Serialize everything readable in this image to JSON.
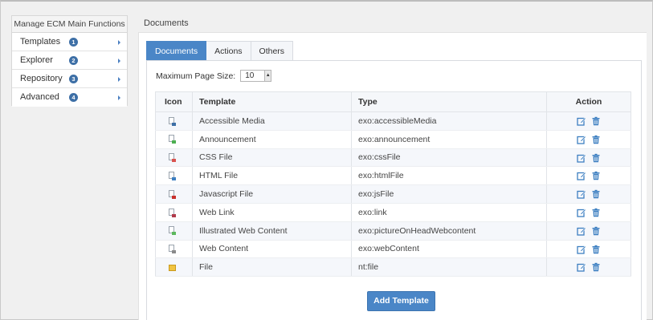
{
  "sidebar": {
    "title": "Manage ECM Main Functions",
    "items": [
      {
        "label": "Templates",
        "badge": "1"
      },
      {
        "label": "Explorer",
        "badge": "2"
      },
      {
        "label": "Repository",
        "badge": "3"
      },
      {
        "label": "Advanced",
        "badge": "4"
      }
    ]
  },
  "main": {
    "header": "Documents",
    "tabs": [
      {
        "label": "Documents",
        "active": true
      },
      {
        "label": "Actions",
        "active": false
      },
      {
        "label": "Others",
        "active": false
      }
    ],
    "page_size": {
      "label": "Maximum Page Size:",
      "value": "10"
    },
    "table": {
      "headers": {
        "icon": "Icon",
        "template": "Template",
        "type": "Type",
        "action": "Action"
      },
      "rows": [
        {
          "icon": "accessible-media-file-icon",
          "template": "Accessible Media",
          "type": "exo:accessibleMedia",
          "color": "#3d6fa6"
        },
        {
          "icon": "announcement-file-icon",
          "template": "Announcement",
          "type": "exo:announcement",
          "color": "#4caf50"
        },
        {
          "icon": "css-file-icon",
          "template": "CSS File",
          "type": "exo:cssFile",
          "color": "#d9534f"
        },
        {
          "icon": "html-file-icon",
          "template": "HTML File",
          "type": "exo:htmlFile",
          "color": "#3d7fc1"
        },
        {
          "icon": "javascript-file-icon",
          "template": "Javascript File",
          "type": "exo:jsFile",
          "color": "#c9302c"
        },
        {
          "icon": "web-link-file-icon",
          "template": "Web Link",
          "type": "exo:link",
          "color": "#b03a4a"
        },
        {
          "icon": "illustrated-web-content-file-icon",
          "template": "Illustrated Web Content",
          "type": "exo:pictureOnHeadWebcontent",
          "color": "#5cb85c"
        },
        {
          "icon": "web-content-file-icon",
          "template": "Web Content",
          "type": "exo:webContent",
          "color": "#8a8a8a"
        },
        {
          "icon": "folder-file-icon",
          "template": "File",
          "type": "nt:file",
          "color": "#f0ad4e"
        }
      ]
    },
    "add_button": "Add Template"
  },
  "colors": {
    "accent": "#4a86c7",
    "badge": "#3d6fa6",
    "action_icon": "#3d7fc1"
  }
}
